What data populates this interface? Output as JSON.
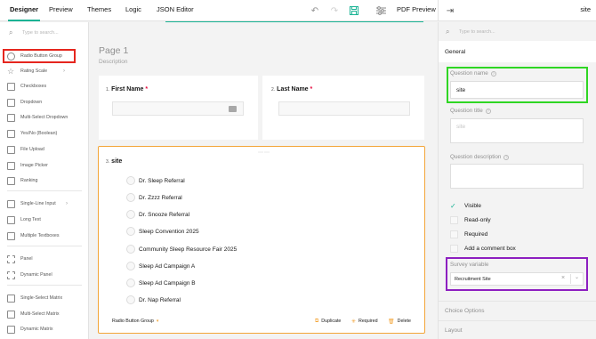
{
  "tabs": [
    {
      "label": "Designer"
    },
    {
      "label": "Preview"
    },
    {
      "label": "Themes"
    },
    {
      "label": "Logic"
    },
    {
      "label": "JSON Editor"
    }
  ],
  "toolbar": {
    "pdf_preview_label": "PDF Preview"
  },
  "panel_header": {
    "title": "site"
  },
  "toolbox": {
    "search_placeholder": "Type to search...",
    "items": [
      {
        "label": "Radio Button Group",
        "icon": "radio-icon"
      },
      {
        "label": "Rating Scale",
        "icon": "star-icon"
      },
      {
        "label": "Checkboxes",
        "icon": "checkbox-icon"
      },
      {
        "label": "Dropdown",
        "icon": "dropdown-icon"
      },
      {
        "label": "Multi-Select Dropdown",
        "icon": "tagbox-icon"
      },
      {
        "label": "Yes/No (Boolean)",
        "icon": "boolean-icon"
      },
      {
        "label": "File Upload",
        "icon": "file-icon"
      },
      {
        "label": "Image Picker",
        "icon": "image-icon"
      },
      {
        "label": "Ranking",
        "icon": "ranking-icon"
      },
      {
        "label": "Single-Line Input",
        "icon": "text-icon"
      },
      {
        "label": "Long Text",
        "icon": "comment-icon"
      },
      {
        "label": "Multiple Textboxes",
        "icon": "multitext-icon"
      },
      {
        "label": "Panel",
        "icon": "panel-icon"
      },
      {
        "label": "Dynamic Panel",
        "icon": "dynamic-panel-icon"
      },
      {
        "label": "Single-Select Matrix",
        "icon": "matrix-icon"
      },
      {
        "label": "Multi-Select Matrix",
        "icon": "matrix-dropdown-icon"
      },
      {
        "label": "Dynamic Matrix",
        "icon": "matrix-dynamic-icon"
      }
    ]
  },
  "page": {
    "title": "Page 1",
    "description": "Description"
  },
  "questions": {
    "q1": {
      "number": "1.",
      "title": "First Name",
      "required_mark": "*"
    },
    "q2": {
      "number": "2.",
      "title": "Last Name",
      "required_mark": "*"
    },
    "q3": {
      "number": "3.",
      "title": "site",
      "choices": [
        "Dr. Sleep Referral",
        "Dr. Zzzz Referral",
        "Dr. Snooze Referral",
        "Sleep Convention 2025",
        "Community Sleep Resource Fair 2025",
        "Sleep Ad Campaign A",
        "Sleep Ad Campaign B",
        "Dr. Nap Referral"
      ],
      "type_label": "Radio Button Group",
      "actions": {
        "duplicate": "Duplicate",
        "required": "Required",
        "delete": "Delete"
      }
    }
  },
  "properties": {
    "search_placeholder": "Type to search...",
    "section_general": "General",
    "question_name_label": "Question name",
    "question_name_value": "site",
    "question_title_label": "Question title",
    "question_title_placeholder": "site",
    "question_description_label": "Question description",
    "checks": [
      {
        "label": "Visible",
        "checked": true
      },
      {
        "label": "Read-only",
        "checked": false
      },
      {
        "label": "Required",
        "checked": false
      },
      {
        "label": "Add a comment box",
        "checked": false
      }
    ],
    "survey_variable_label": "Survey variable",
    "survey_variable_value": "Recruitment Site",
    "section_choice_options": "Choice Options",
    "section_layout": "Layout"
  },
  "colors": {
    "accent": "#19b394",
    "selection": "#f3a538",
    "highlight_red": "#e5261e",
    "highlight_green": "#2fd623",
    "highlight_purple": "#8d1fc0"
  }
}
